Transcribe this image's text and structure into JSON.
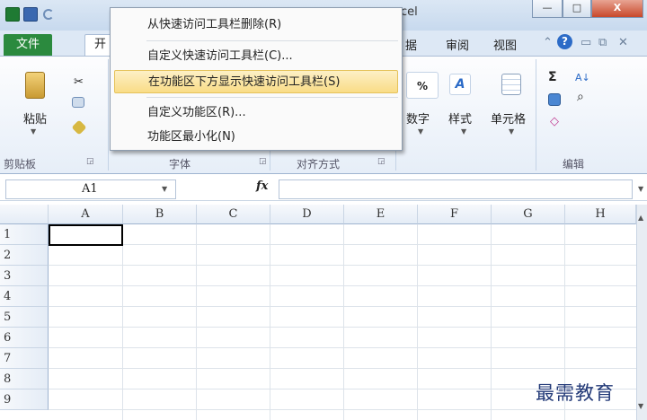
{
  "window": {
    "title_fragment": "cel",
    "minimize": "—",
    "maximize": "□",
    "close": "X"
  },
  "tabs": {
    "file": "文件",
    "home": "开",
    "data": "据",
    "review": "审阅",
    "view": "视图"
  },
  "ribbon": {
    "paste": "粘贴",
    "number": "数字",
    "styles": "样式",
    "cells": "单元格",
    "percent": "%",
    "groups": {
      "clipboard": "剪贴板",
      "font": "字体",
      "alignment": "对齐方式",
      "editing": "编辑"
    },
    "glyphs": {
      "sigma": "Σ",
      "sort": "A↓",
      "find": "⌕",
      "clear": "◇"
    }
  },
  "formula_bar": {
    "name_box": "A1",
    "fx": "fx",
    "value": ""
  },
  "grid": {
    "columns": [
      "A",
      "B",
      "C",
      "D",
      "E",
      "F",
      "G",
      "H"
    ],
    "rows": [
      "1",
      "2",
      "3",
      "4",
      "5",
      "6",
      "7",
      "8",
      "9"
    ],
    "selected_cell": "A1"
  },
  "context_menu": {
    "items": [
      {
        "label": "从快速访问工具栏删除(R)"
      },
      {
        "label": "自定义快速访问工具栏(C)..."
      },
      {
        "label": "在功能区下方显示快速访问工具栏(S)"
      },
      {
        "label": "自定义功能区(R)..."
      },
      {
        "label": "功能区最小化(N)"
      }
    ],
    "highlighted_index": 2
  },
  "watermark": "最需教育",
  "colors": {
    "file_tab": "#2b8a3e",
    "menu_highlight": "#f9dc86",
    "excel_icon": "#1f7a33"
  }
}
